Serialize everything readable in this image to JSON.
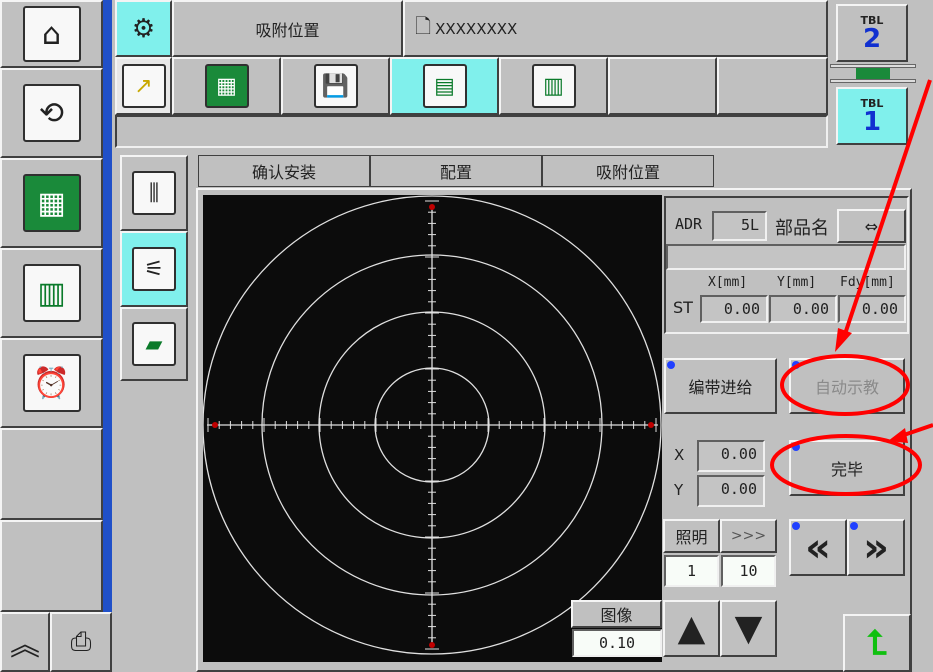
{
  "sidebar": {
    "items": [
      {
        "icon": "home-icon"
      },
      {
        "icon": "sync-arrows-icon"
      },
      {
        "icon": "pcb-boards-icon",
        "selected": true
      },
      {
        "icon": "report-chart-icon"
      },
      {
        "icon": "alarm-clock-tool-icon"
      }
    ],
    "bottom": [
      {
        "icon": "chevron-double-up-icon"
      },
      {
        "icon": "printer-icon"
      }
    ]
  },
  "header": {
    "title": "吸附位置",
    "file_name": "XXXXXXXX",
    "toolbar": [
      {
        "icon": "trend-arrow-icon"
      },
      {
        "icon": "pcb-boards-icon"
      },
      {
        "icon": "floppy-disk-icon"
      },
      {
        "icon": "feeder-cart-icon",
        "selected": true
      },
      {
        "icon": "bar-chart-icon"
      },
      {},
      {}
    ]
  },
  "tables": {
    "tbl2_label": "TBL",
    "tbl2_num": "2",
    "tbl1_label": "TBL",
    "tbl1_num": "1",
    "active": "1"
  },
  "tool_tabs": [
    {
      "icon": "nozzle-head-icon"
    },
    {
      "icon": "tape-feeder-icon",
      "selected": true
    },
    {
      "icon": "tray-icon"
    }
  ],
  "tabs": [
    {
      "label": "确认安装"
    },
    {
      "label": "配置"
    },
    {
      "label": "吸附位置",
      "selected": true
    }
  ],
  "info": {
    "adr_label": "ADR",
    "adr_value": "5L",
    "part_name_label": "部品名",
    "swap_label": "⇔",
    "part_name_value": "",
    "col_x": "X[mm]",
    "col_y": "Y[mm]",
    "col_fdy": "Fdy[mm]",
    "row_label": "ST",
    "st_x": "0.00",
    "st_y": "0.00",
    "st_fdy": "0.00"
  },
  "actions": {
    "tape_feed": "编带进给",
    "auto_teach": "自动示教",
    "finish": "完毕"
  },
  "position": {
    "x_label": "X",
    "x_value": "0.00",
    "y_label": "Y",
    "y_value": "0.00"
  },
  "lighting": {
    "label": "照明",
    "next_label": ">>>",
    "value1": "1",
    "value2": "10"
  },
  "image": {
    "label": "图像",
    "value": "0.10"
  },
  "colors": {
    "selected": "#80f0ec",
    "annotation": "#ff0000",
    "sidebar_border": "#2050c8"
  }
}
